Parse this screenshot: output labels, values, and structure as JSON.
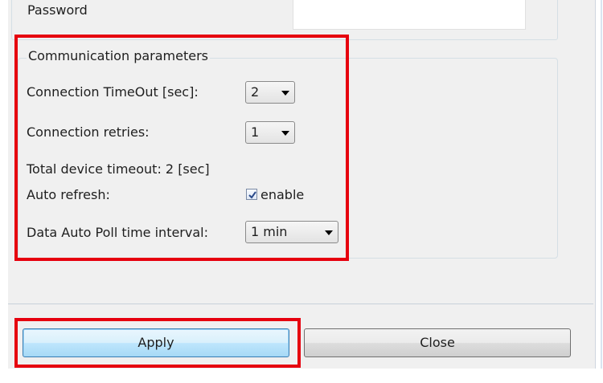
{
  "password": {
    "label": "Password",
    "value": ""
  },
  "communication": {
    "group_title": "Communication parameters",
    "timeout": {
      "label": "Connection TimeOut [sec]:",
      "value": "2"
    },
    "retries": {
      "label": "Connection retries:",
      "value": "1"
    },
    "total_timeout_text": "Total device timeout: 2 [sec]",
    "auto_refresh": {
      "label": "Auto refresh:",
      "checkbox_label": "enable",
      "checked": true
    },
    "poll_interval": {
      "label": "Data Auto Poll time interval:",
      "value": "1 min"
    }
  },
  "buttons": {
    "apply_label": "Apply",
    "close_label": "Close"
  },
  "colors": {
    "highlight": "#e6000e",
    "window_bg": "#f0f0f0",
    "default_button_border": "#3c7fb1"
  }
}
